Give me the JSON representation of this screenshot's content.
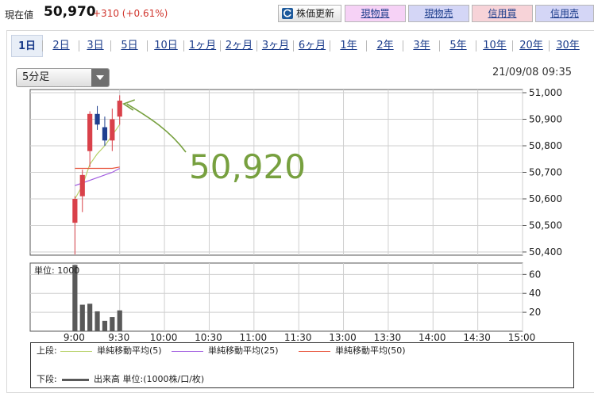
{
  "quote": {
    "label": "現在値",
    "price": "50,970",
    "change": "+310 (+0.61%)"
  },
  "toolbar": {
    "refresh_label": "株価更新",
    "buy_label": "現物買",
    "sell_label": "現物売",
    "margin_buy_label": "信用買",
    "margin_sell_label": "信用売"
  },
  "tabs": [
    "1日",
    "2日",
    "3日",
    "5日",
    "10日",
    "1ヶ月",
    "2ヶ月",
    "3ヶ月",
    "6ヶ月",
    "1年",
    "2年",
    "3年",
    "5年",
    "10年",
    "20年",
    "30年"
  ],
  "active_tab": "1日",
  "interval_select": {
    "value": "5分足"
  },
  "timestamp": "21/09/08 09:35",
  "annotation": {
    "text": "50,920",
    "color": "#77a03f"
  },
  "colors": {
    "up": "#d9414a",
    "down": "#1f3f8f",
    "volume": "#595959",
    "ma5": "#b7d168",
    "ma25": "#a25ee0",
    "ma50": "#e8533a"
  },
  "chart_data": [
    {
      "type": "candlestick",
      "title": "",
      "x_ticks": [
        "9:00",
        "9:30",
        "10:00",
        "10:30",
        "11:00",
        "11:30",
        "13:00",
        "13:30",
        "14:00",
        "14:30",
        "15:00"
      ],
      "y_ticks": [
        "51,000",
        "50,900",
        "50,800",
        "50,700",
        "50,600",
        "50,500",
        "50,400"
      ],
      "ylim": [
        50400,
        51000
      ],
      "grid": true,
      "candles": [
        {
          "time": "9:00",
          "open": 50510,
          "high": 50610,
          "low": 50390,
          "close": 50600
        },
        {
          "time": "9:05",
          "open": 50610,
          "high": 50710,
          "low": 50550,
          "close": 50690
        },
        {
          "time": "9:10",
          "open": 50780,
          "high": 50930,
          "low": 50720,
          "close": 50920
        },
        {
          "time": "9:15",
          "open": 50920,
          "high": 50950,
          "low": 50860,
          "close": 50880
        },
        {
          "time": "9:20",
          "open": 50870,
          "high": 50910,
          "low": 50800,
          "close": 50820
        },
        {
          "time": "9:25",
          "open": 50820,
          "high": 50940,
          "low": 50780,
          "close": 50900
        },
        {
          "time": "9:30",
          "open": 50910,
          "high": 50990,
          "low": 50880,
          "close": 50970
        }
      ],
      "series": [
        {
          "name": "単純移動平均(5)",
          "values": [
            50600,
            50650,
            50730,
            50770,
            50800,
            50840,
            50880
          ]
        },
        {
          "name": "単純移動平均(25)",
          "values": [
            50650,
            50660,
            50670,
            50680,
            50690,
            50700,
            50715
          ]
        },
        {
          "name": "単純移動平均(50)",
          "values": [
            50715,
            50715,
            50715,
            50715,
            50715,
            50715,
            50720
          ]
        }
      ]
    },
    {
      "type": "bar",
      "title": "単位: 1000",
      "y_ticks": [
        "60",
        "40",
        "20"
      ],
      "ylim": [
        0,
        72
      ],
      "grid": true,
      "categories": [
        "9:00",
        "9:05",
        "9:10",
        "9:15",
        "9:20",
        "9:25",
        "9:30"
      ],
      "values": [
        70,
        28,
        29,
        21,
        11,
        15,
        22
      ]
    }
  ],
  "legend": {
    "upper_label": "上段:",
    "lower_label": "下段:",
    "ma5": "単純移動平均(5)",
    "ma25": "単純移動平均(25)",
    "ma50": "単純移動平均(50)",
    "volume": "出来高 単位:(1000株/口/枚)"
  }
}
